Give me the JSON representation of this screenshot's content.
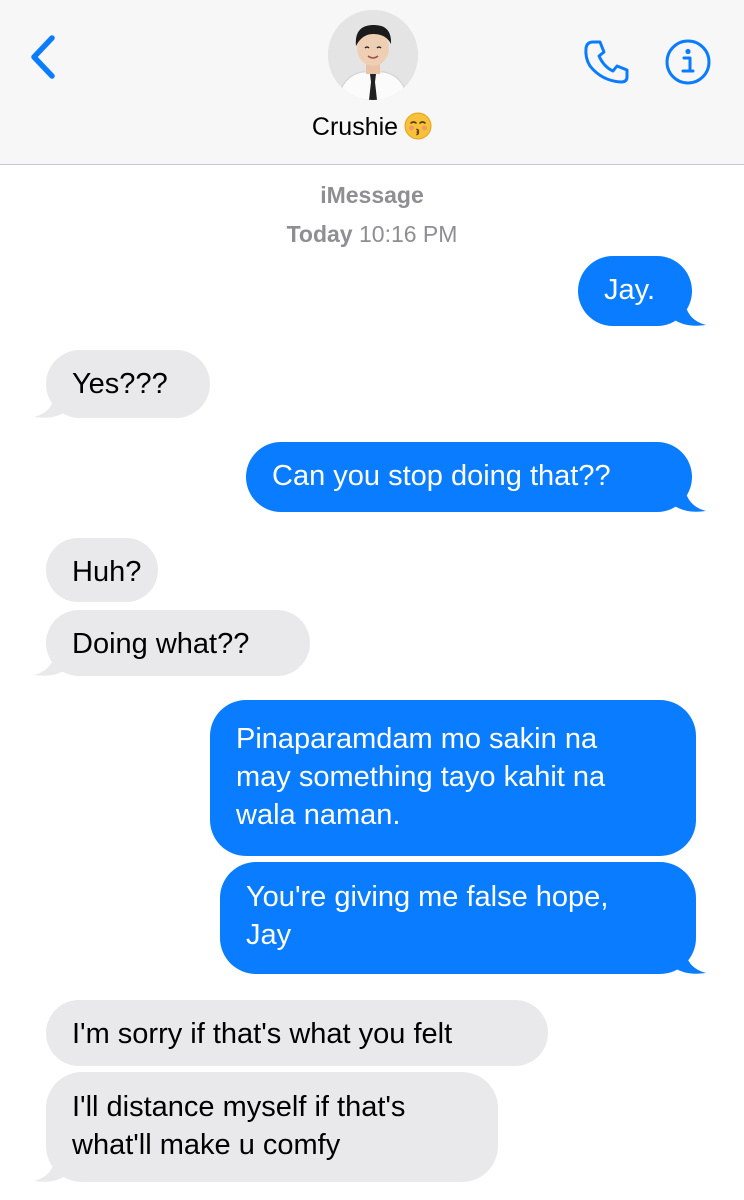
{
  "header": {
    "contact_name": "Crushie",
    "back_icon": "chevron-left-icon",
    "phone_icon": "phone-icon",
    "info_icon": "info-icon",
    "accent_color": "#0a7cff"
  },
  "thread": {
    "service": "iMessage",
    "timestamp_day": "Today",
    "timestamp_time": "10:16 PM"
  },
  "messages": [
    {
      "from": "me",
      "text": "Jay."
    },
    {
      "from": "them",
      "text": "Yes???"
    },
    {
      "from": "me",
      "text": "Can you stop doing that??"
    },
    {
      "from": "them",
      "text": "Huh?"
    },
    {
      "from": "them",
      "text": "Doing what??"
    },
    {
      "from": "me",
      "line1": "Pinaparamdam mo sakin na",
      "line2": "may something tayo kahit na",
      "line3": "wala naman."
    },
    {
      "from": "me",
      "line1": "You're giving me false hope,",
      "line2": "Jay"
    },
    {
      "from": "them",
      "text": "I'm sorry if that's what you felt"
    },
    {
      "from": "them",
      "line1": "I'll distance myself if that's",
      "line2": "what'll make u comfy"
    }
  ],
  "colors": {
    "sent_bubble": "#0a7cff",
    "received_bubble": "#e9e9eb",
    "meta_text": "#8e8e93"
  }
}
